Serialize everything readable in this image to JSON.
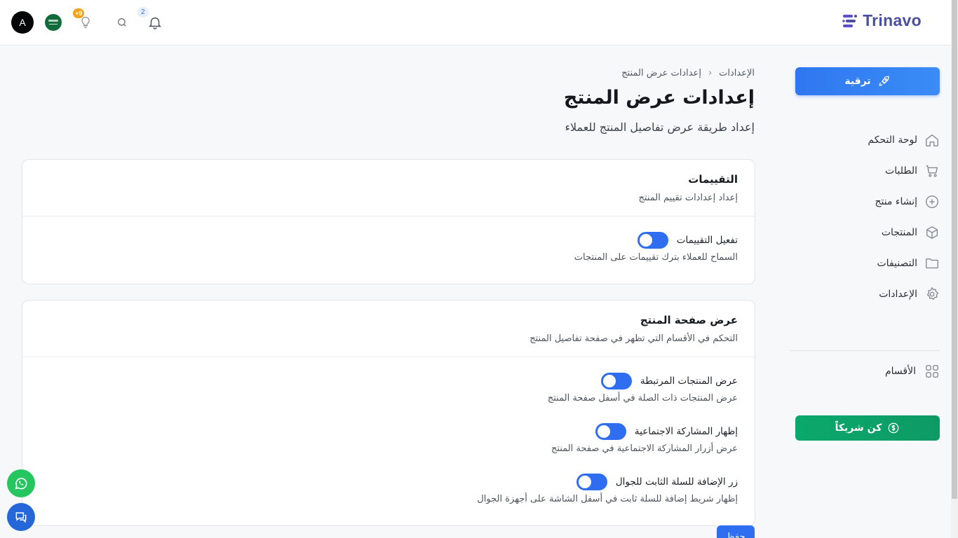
{
  "header": {
    "brand": "Trinavo",
    "avatar_letter": "A",
    "ideas_badge": "+9",
    "notifications_badge": "2"
  },
  "sidebar": {
    "upgrade_label": "ترقية",
    "items": [
      {
        "label": "لوحة التحكم",
        "icon": "home-icon"
      },
      {
        "label": "الطلبات",
        "icon": "cart-icon"
      },
      {
        "label": "إنشاء منتج",
        "icon": "plus-circle-icon"
      },
      {
        "label": "المنتجات",
        "icon": "box-icon"
      },
      {
        "label": "التصنيفات",
        "icon": "folder-icon"
      },
      {
        "label": "الإعدادات",
        "icon": "gear-icon"
      }
    ],
    "sections_label": "الأقسام",
    "partner_label": "كن شريكاً"
  },
  "breadcrumb": {
    "parent": "الإعدادات",
    "current": "إعدادات عرض المنتج"
  },
  "page": {
    "title": "إعدادات عرض المنتج",
    "subtitle": "إعداد طريقة عرض تفاصيل المنتج للعملاء"
  },
  "reviews_card": {
    "title": "التقييمات",
    "description": "إعداد إعدادات تقييم المنتج",
    "settings": [
      {
        "label": "تفعيل التقييمات",
        "hint": "السماح للعملاء بترك تقييمات على المنتجات",
        "enabled": true
      }
    ]
  },
  "product_page_card": {
    "title": "عرض صفحة المنتج",
    "description": "التحكم في الأقسام التي تظهر في صفحة تفاصيل المنتج",
    "settings": [
      {
        "label": "عرض المنتجات المرتبطة",
        "hint": "عرض المنتجات ذات الصلة في أسفل صفحة المنتج",
        "enabled": true
      },
      {
        "label": "إظهار المشاركة الاجتماعية",
        "hint": "عرض أزرار المشاركة الاجتماعية في صفحة المنتج",
        "enabled": true
      },
      {
        "label": "زر الإضافة للسلة الثابت للجوال",
        "hint": "إظهار شريط إضافة للسلة ثابت في أسفل الشاشة على أجهزة الجوال",
        "enabled": true
      }
    ]
  },
  "save_label": "حفظ",
  "colors": {
    "primary": "#2f6ef0",
    "success": "#0ba86b",
    "brand": "#4a4fa0",
    "whatsapp": "#25c560"
  }
}
